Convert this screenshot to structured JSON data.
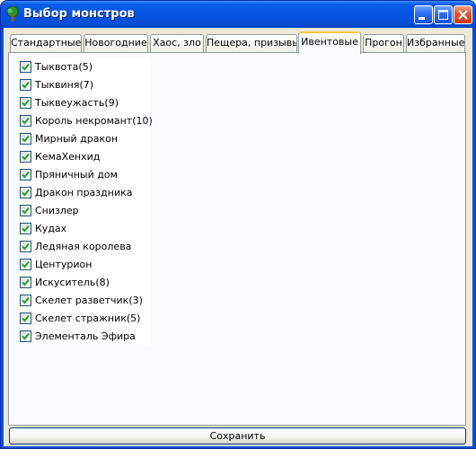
{
  "window": {
    "title": "Выбор монстров",
    "icon": "tree-icon"
  },
  "tabs": [
    {
      "label": "Стандартные",
      "active": false
    },
    {
      "label": "Новогодние",
      "active": false
    },
    {
      "label": "Хаос, зло",
      "active": false
    },
    {
      "label": "Пещера, призывы",
      "active": false
    },
    {
      "label": "Ивентовые",
      "active": true
    },
    {
      "label": "Прогон",
      "active": false
    },
    {
      "label": "Избранные",
      "active": false
    }
  ],
  "items": [
    {
      "label": "Тыквота(5)",
      "checked": true
    },
    {
      "label": "Тыквиня(7)",
      "checked": true
    },
    {
      "label": "Тыквеужасть(9)",
      "checked": true
    },
    {
      "label": "Король некромант(10)",
      "checked": true
    },
    {
      "label": "Мирный дракон",
      "checked": true
    },
    {
      "label": "КемаХенхид",
      "checked": true
    },
    {
      "label": "Пряничный дом",
      "checked": true
    },
    {
      "label": "Дракон праздника",
      "checked": true
    },
    {
      "label": "Снизлер",
      "checked": true
    },
    {
      "label": "Кудах",
      "checked": true
    },
    {
      "label": "Ледяная королева",
      "checked": true
    },
    {
      "label": "Центурион",
      "checked": true
    },
    {
      "label": "Искуситель(8)",
      "checked": true
    },
    {
      "label": "Скелет разветчик(3)",
      "checked": true
    },
    {
      "label": "Скелет стражник(5)",
      "checked": true
    },
    {
      "label": "Элементаль Эфира",
      "checked": true
    }
  ],
  "save_button": {
    "label": "Сохранить"
  },
  "colors": {
    "titlebar": "#0a4fd8",
    "client_bg": "#ece9d8",
    "active_tab_accent": "#ffc73c",
    "checkmark": "#21a121"
  }
}
